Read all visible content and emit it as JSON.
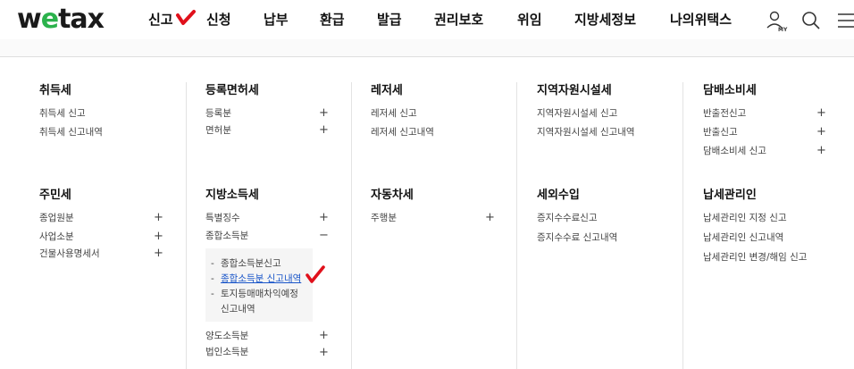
{
  "header": {
    "logo_text_1": "w",
    "logo_text_2": "e",
    "logo_text_3": "tax",
    "nav": [
      "신고",
      "신청",
      "납부",
      "환급",
      "발급",
      "권리보호",
      "위임",
      "지방세정보",
      "나의위택스"
    ],
    "my_label": "MY"
  },
  "columns": {
    "c1": {
      "s1": {
        "title": "취득세",
        "items": [
          "취득세 신고",
          "취득세 신고내역"
        ]
      },
      "s2": {
        "title": "주민세",
        "items": [
          "종업원분",
          "사업소분",
          "건물사용명세서"
        ]
      }
    },
    "c2": {
      "s1": {
        "title": "등록면허세",
        "items": [
          "등록분",
          "면허분"
        ]
      },
      "s2": {
        "title": "지방소득세",
        "items": [
          "특별징수",
          "종합소득분"
        ],
        "sub": [
          "종합소득분신고",
          "종합소득분 신고내역",
          "토지등매매차익예정",
          "신고내역"
        ],
        "more": [
          "양도소득분",
          "법인소득분"
        ]
      }
    },
    "c3": {
      "s1": {
        "title": "레저세",
        "items": [
          "레저세 신고",
          "레저세 신고내역"
        ]
      },
      "s2": {
        "title": "자동차세",
        "items": [
          "주행분"
        ]
      }
    },
    "c4": {
      "s1": {
        "title": "지역자원시설세",
        "items": [
          "지역자원시설세 신고",
          "지역자원시설세 신고내역"
        ]
      },
      "s2": {
        "title": "세외수입",
        "items": [
          "증지수수료신고",
          "증지수수료 신고내역"
        ]
      }
    },
    "c5": {
      "s1": {
        "title": "담배소비세",
        "items": [
          "반출전신고",
          "반출신고",
          "담배소비세 신고"
        ]
      },
      "s2": {
        "title": "납세관리인",
        "items": [
          "납세관리인 지정 신고",
          "납세관리인 신고내역",
          "납세관리인 변경/해임 신고"
        ]
      }
    }
  },
  "symbols": {
    "plus": "+",
    "minus": "−",
    "dash": "-"
  },
  "colors": {
    "accent_red": "#e0101b",
    "logo_green": "#2bb24c",
    "link_blue": "#1a56c9"
  }
}
